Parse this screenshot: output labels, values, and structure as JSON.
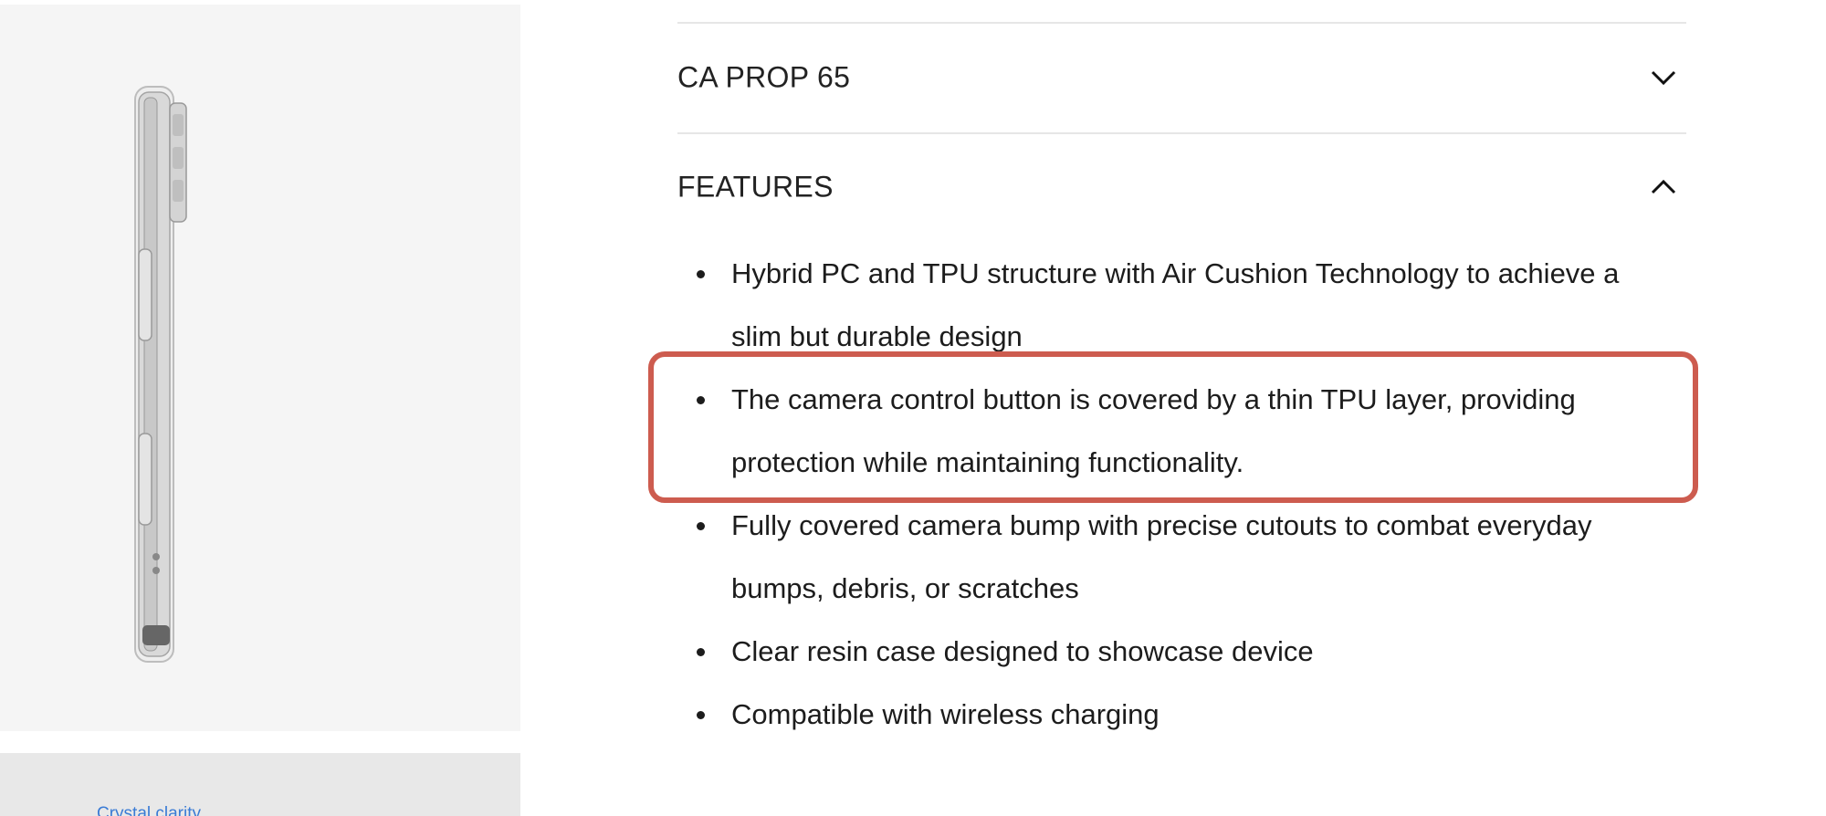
{
  "product_image": {
    "alt": "Clear phone case side view"
  },
  "thumbnail": {
    "caption": "Crystal clarity"
  },
  "accordion": {
    "ca_prop": {
      "title": "CA PROP 65",
      "state": "collapsed",
      "icon": "chevron-down-icon"
    },
    "features": {
      "title": "FEATURES",
      "state": "expanded",
      "icon": "chevron-up-icon",
      "items": [
        "Hybrid PC and TPU structure with Air Cushion Technology to achieve a slim but durable design",
        "The camera control button is covered by a thin TPU layer, providing protection while maintaining functionality.",
        "Fully covered camera bump with precise cutouts to combat everyday bumps, debris, or scratches",
        "Clear resin case designed to showcase device",
        "Compatible with wireless charging"
      ]
    }
  },
  "colors": {
    "highlight": "#cd5c4f",
    "divider": "#e6e6e6",
    "image_bg": "#f5f5f5",
    "link": "#3a7bd5"
  }
}
